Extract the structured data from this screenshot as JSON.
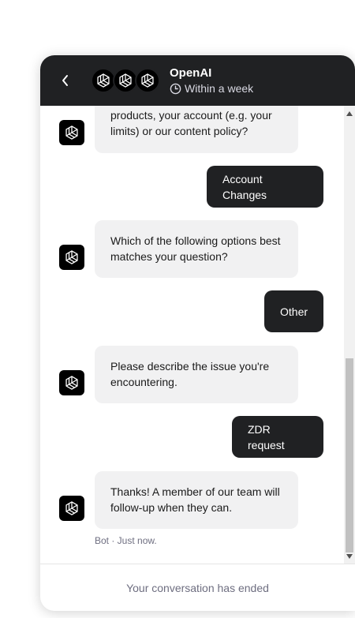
{
  "header": {
    "title": "OpenAI",
    "response_time": "Within a week",
    "icons": [
      "chevron-left-icon",
      "openai-logo-icon",
      "clock-icon"
    ]
  },
  "messages": [
    {
      "from": "bot",
      "text": "products, your account (e.g. your limits) or our content policy?"
    },
    {
      "from": "user",
      "text": "Account Changes"
    },
    {
      "from": "bot",
      "text": "Which of the following options best matches your question?"
    },
    {
      "from": "user",
      "text": "Other"
    },
    {
      "from": "bot",
      "text": "Please describe the issue you're encountering."
    },
    {
      "from": "user",
      "text": "ZDR request"
    },
    {
      "from": "bot",
      "text": "Thanks! A member of our team will follow-up when they can."
    }
  ],
  "last_message_meta": "Bot · Just now.",
  "footer": {
    "status": "Your conversation has ended"
  },
  "colors": {
    "header_bg": "#202123",
    "user_bubble": "#202123",
    "bot_bubble": "#f1f1f2"
  }
}
